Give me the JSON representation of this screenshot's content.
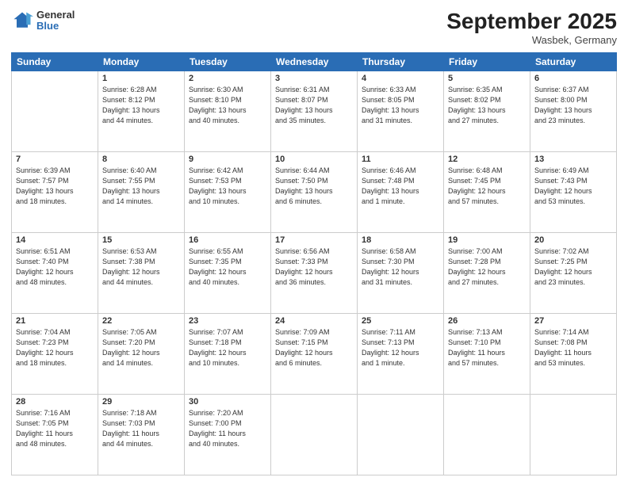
{
  "header": {
    "logo": {
      "general": "General",
      "blue": "Blue"
    },
    "title": "September 2025",
    "location": "Wasbek, Germany"
  },
  "weekdays": [
    "Sunday",
    "Monday",
    "Tuesday",
    "Wednesday",
    "Thursday",
    "Friday",
    "Saturday"
  ],
  "weeks": [
    [
      {
        "day": "",
        "content": ""
      },
      {
        "day": "1",
        "content": "Sunrise: 6:28 AM\nSunset: 8:12 PM\nDaylight: 13 hours\nand 44 minutes."
      },
      {
        "day": "2",
        "content": "Sunrise: 6:30 AM\nSunset: 8:10 PM\nDaylight: 13 hours\nand 40 minutes."
      },
      {
        "day": "3",
        "content": "Sunrise: 6:31 AM\nSunset: 8:07 PM\nDaylight: 13 hours\nand 35 minutes."
      },
      {
        "day": "4",
        "content": "Sunrise: 6:33 AM\nSunset: 8:05 PM\nDaylight: 13 hours\nand 31 minutes."
      },
      {
        "day": "5",
        "content": "Sunrise: 6:35 AM\nSunset: 8:02 PM\nDaylight: 13 hours\nand 27 minutes."
      },
      {
        "day": "6",
        "content": "Sunrise: 6:37 AM\nSunset: 8:00 PM\nDaylight: 13 hours\nand 23 minutes."
      }
    ],
    [
      {
        "day": "7",
        "content": "Sunrise: 6:39 AM\nSunset: 7:57 PM\nDaylight: 13 hours\nand 18 minutes."
      },
      {
        "day": "8",
        "content": "Sunrise: 6:40 AM\nSunset: 7:55 PM\nDaylight: 13 hours\nand 14 minutes."
      },
      {
        "day": "9",
        "content": "Sunrise: 6:42 AM\nSunset: 7:53 PM\nDaylight: 13 hours\nand 10 minutes."
      },
      {
        "day": "10",
        "content": "Sunrise: 6:44 AM\nSunset: 7:50 PM\nDaylight: 13 hours\nand 6 minutes."
      },
      {
        "day": "11",
        "content": "Sunrise: 6:46 AM\nSunset: 7:48 PM\nDaylight: 13 hours\nand 1 minute."
      },
      {
        "day": "12",
        "content": "Sunrise: 6:48 AM\nSunset: 7:45 PM\nDaylight: 12 hours\nand 57 minutes."
      },
      {
        "day": "13",
        "content": "Sunrise: 6:49 AM\nSunset: 7:43 PM\nDaylight: 12 hours\nand 53 minutes."
      }
    ],
    [
      {
        "day": "14",
        "content": "Sunrise: 6:51 AM\nSunset: 7:40 PM\nDaylight: 12 hours\nand 48 minutes."
      },
      {
        "day": "15",
        "content": "Sunrise: 6:53 AM\nSunset: 7:38 PM\nDaylight: 12 hours\nand 44 minutes."
      },
      {
        "day": "16",
        "content": "Sunrise: 6:55 AM\nSunset: 7:35 PM\nDaylight: 12 hours\nand 40 minutes."
      },
      {
        "day": "17",
        "content": "Sunrise: 6:56 AM\nSunset: 7:33 PM\nDaylight: 12 hours\nand 36 minutes."
      },
      {
        "day": "18",
        "content": "Sunrise: 6:58 AM\nSunset: 7:30 PM\nDaylight: 12 hours\nand 31 minutes."
      },
      {
        "day": "19",
        "content": "Sunrise: 7:00 AM\nSunset: 7:28 PM\nDaylight: 12 hours\nand 27 minutes."
      },
      {
        "day": "20",
        "content": "Sunrise: 7:02 AM\nSunset: 7:25 PM\nDaylight: 12 hours\nand 23 minutes."
      }
    ],
    [
      {
        "day": "21",
        "content": "Sunrise: 7:04 AM\nSunset: 7:23 PM\nDaylight: 12 hours\nand 18 minutes."
      },
      {
        "day": "22",
        "content": "Sunrise: 7:05 AM\nSunset: 7:20 PM\nDaylight: 12 hours\nand 14 minutes."
      },
      {
        "day": "23",
        "content": "Sunrise: 7:07 AM\nSunset: 7:18 PM\nDaylight: 12 hours\nand 10 minutes."
      },
      {
        "day": "24",
        "content": "Sunrise: 7:09 AM\nSunset: 7:15 PM\nDaylight: 12 hours\nand 6 minutes."
      },
      {
        "day": "25",
        "content": "Sunrise: 7:11 AM\nSunset: 7:13 PM\nDaylight: 12 hours\nand 1 minute."
      },
      {
        "day": "26",
        "content": "Sunrise: 7:13 AM\nSunset: 7:10 PM\nDaylight: 11 hours\nand 57 minutes."
      },
      {
        "day": "27",
        "content": "Sunrise: 7:14 AM\nSunset: 7:08 PM\nDaylight: 11 hours\nand 53 minutes."
      }
    ],
    [
      {
        "day": "28",
        "content": "Sunrise: 7:16 AM\nSunset: 7:05 PM\nDaylight: 11 hours\nand 48 minutes."
      },
      {
        "day": "29",
        "content": "Sunrise: 7:18 AM\nSunset: 7:03 PM\nDaylight: 11 hours\nand 44 minutes."
      },
      {
        "day": "30",
        "content": "Sunrise: 7:20 AM\nSunset: 7:00 PM\nDaylight: 11 hours\nand 40 minutes."
      },
      {
        "day": "",
        "content": ""
      },
      {
        "day": "",
        "content": ""
      },
      {
        "day": "",
        "content": ""
      },
      {
        "day": "",
        "content": ""
      }
    ]
  ]
}
